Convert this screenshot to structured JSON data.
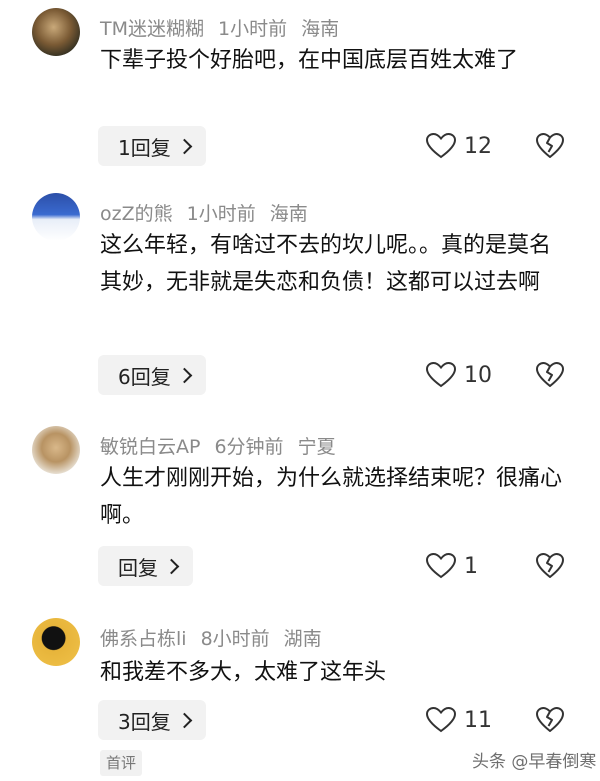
{
  "comments": [
    {
      "username": "TM迷迷糊糊",
      "time": "1小时前",
      "location": "海南",
      "text": "下辈子投个好胎吧，在中国底层百姓太难了",
      "reply_label": "1回复",
      "likes": "12"
    },
    {
      "username": "ozZ的熊",
      "time": "1小时前",
      "location": "海南",
      "text": "这么年轻，有啥过不去的坎儿呢。。真的是莫名其妙，无非就是失恋和负债！这都可以过去啊",
      "reply_label": "6回复",
      "likes": "10"
    },
    {
      "username": "敏锐白云AP",
      "time": "6分钟前",
      "location": "宁夏",
      "text": "人生才刚刚开始，为什么就选择结束呢？很痛心啊。",
      "reply_label": "回复",
      "likes": "1"
    },
    {
      "username": "佛系占栋li",
      "time": "8小时前",
      "location": "湖南",
      "text": "和我差不多大，太难了这年头",
      "reply_label": "3回复",
      "likes": "11"
    }
  ],
  "first_comment_tag": "首评",
  "watermark": "头条 @早春倒寒",
  "icons": {
    "like": "heart-outline-icon",
    "dislike": "broken-heart-icon"
  }
}
